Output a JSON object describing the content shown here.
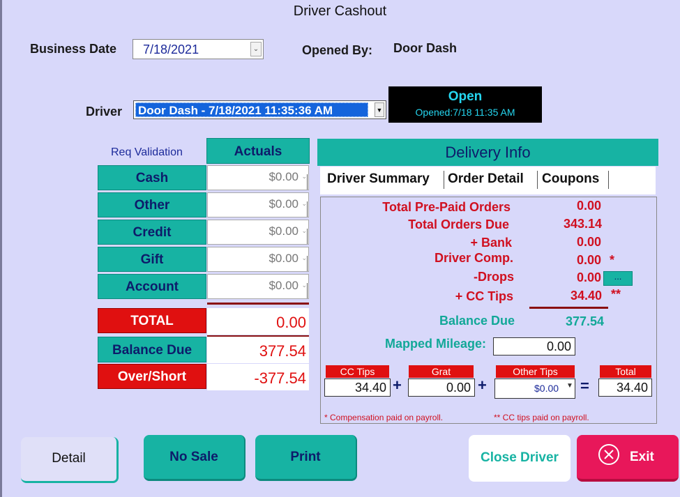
{
  "title": "Driver Cashout",
  "business_date": {
    "label": "Business Date",
    "value": "7/18/2021"
  },
  "opened_by": {
    "label": "Opened By:",
    "value": "Door Dash"
  },
  "driver": {
    "label": "Driver",
    "selected": "Door Dash - 7/18/2021 11:35:36 AM"
  },
  "status": {
    "state": "Open",
    "opened": "Opened:7/18 11:35 AM"
  },
  "req_validation": "Req Validation",
  "actuals_header": "Actuals",
  "payments": [
    {
      "label": "Cash",
      "value": "$0.00"
    },
    {
      "label": "Other",
      "value": "$0.00"
    },
    {
      "label": "Credit",
      "value": "$0.00"
    },
    {
      "label": "Gift",
      "value": "$0.00"
    },
    {
      "label": "Account",
      "value": "$0.00"
    }
  ],
  "totals": {
    "total_label": "TOTAL",
    "total_value": "0.00",
    "balance_label": "Balance Due",
    "balance_value": "377.54",
    "over_label": "Over/Short",
    "over_value": "-377.54"
  },
  "delivery": {
    "header": "Delivery Info",
    "tabs": [
      "Driver Summary",
      "Order Detail",
      "Coupons"
    ],
    "summary": [
      {
        "label": "Total Pre-Paid Orders",
        "value": "0.00",
        "mark": ""
      },
      {
        "label": "Total Orders Due",
        "value": "343.14",
        "mark": ""
      },
      {
        "label": "+ Bank",
        "value": "0.00",
        "mark": ""
      },
      {
        "label": "Driver Comp.",
        "value": "0.00",
        "mark": "*"
      },
      {
        "label": "-Drops",
        "value": "0.00",
        "mark": ""
      },
      {
        "label": "+ CC Tips",
        "value": "34.40",
        "mark": "**"
      }
    ],
    "drops_button": "...",
    "balance_due_label": "Balance Due",
    "balance_due_value": "377.54",
    "mileage_label": "Mapped Mileage:",
    "mileage_value": "0.00",
    "tips": {
      "cc_label": "CC Tips",
      "cc_value": "34.40",
      "grat_label": "Grat",
      "grat_value": "0.00",
      "other_label": "Other Tips",
      "other_value": "$0.00",
      "total_label": "Total",
      "total_value": "34.40",
      "plus": "+",
      "equals": "="
    },
    "note1": "* Compensation paid on payroll.",
    "note2": "** CC tips paid on payroll."
  },
  "buttons": {
    "detail": "Detail",
    "no_sale": "No Sale",
    "print": "Print",
    "close_driver": "Close Driver",
    "exit": "Exit"
  }
}
